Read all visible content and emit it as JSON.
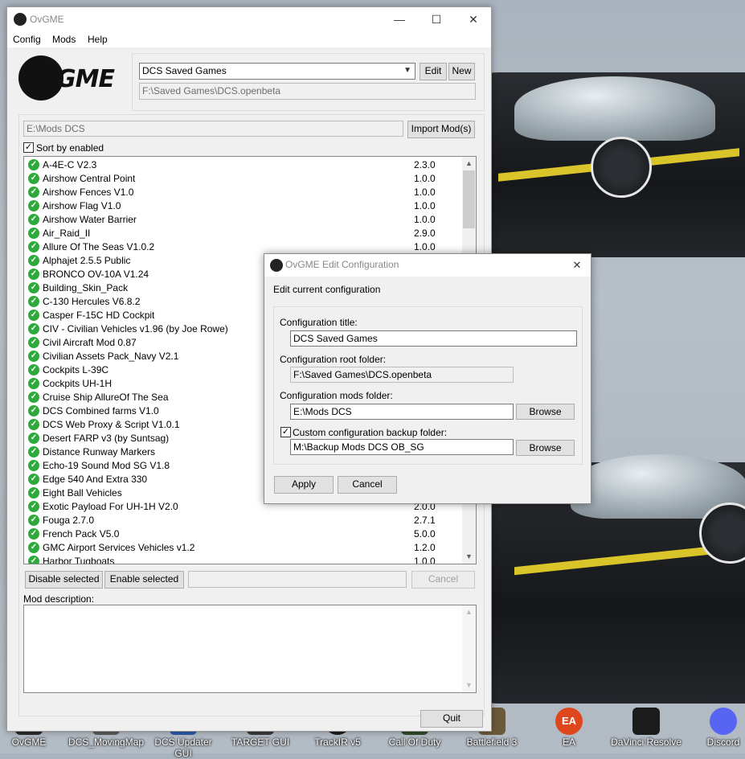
{
  "main_window": {
    "title": "OvGME",
    "logo_text": "OvGME",
    "menu": [
      "Config",
      "Mods",
      "Help"
    ],
    "config_select": "DCS Saved Games",
    "edit_label": "Edit",
    "new_label": "New",
    "config_path": "F:\\Saved Games\\DCS.openbeta",
    "mods_path": "E:\\Mods DCS",
    "import_label": "Import Mod(s)",
    "sort_label": "Sort by enabled",
    "mods": [
      {
        "name": "A-4E-C V2.3",
        "version": "2.3.0"
      },
      {
        "name": "Airshow Central Point",
        "version": "1.0.0"
      },
      {
        "name": "Airshow Fences V1.0",
        "version": "1.0.0"
      },
      {
        "name": "Airshow Flag V1.0",
        "version": "1.0.0"
      },
      {
        "name": "Airshow Water Barrier",
        "version": "1.0.0"
      },
      {
        "name": "Air_Raid_II",
        "version": "2.9.0"
      },
      {
        "name": "Allure Of The Seas V1.0.2",
        "version": "1.0.0"
      },
      {
        "name": "Alphajet 2.5.5 Public",
        "version": ""
      },
      {
        "name": "BRONCO OV-10A V1.24",
        "version": ""
      },
      {
        "name": "Building_Skin_Pack",
        "version": ""
      },
      {
        "name": "C-130 Hercules V6.8.2",
        "version": ""
      },
      {
        "name": "Casper F-15C HD Cockpit",
        "version": ""
      },
      {
        "name": "CIV - Civilian Vehicles v1.96 (by Joe Rowe)",
        "version": ""
      },
      {
        "name": "Civil Aircraft Mod 0.87",
        "version": ""
      },
      {
        "name": "Civilian Assets Pack_Navy V2.1",
        "version": ""
      },
      {
        "name": "Cockpits L-39C",
        "version": ""
      },
      {
        "name": "Cockpits UH-1H",
        "version": ""
      },
      {
        "name": "Cruise Ship AllureOf The Sea",
        "version": ""
      },
      {
        "name": "DCS Combined farms V1.0",
        "version": ""
      },
      {
        "name": "DCS Web Proxy & Script V1.0.1",
        "version": ""
      },
      {
        "name": "Desert FARP v3 (by Suntsag)",
        "version": ""
      },
      {
        "name": "Distance Runway Markers",
        "version": ""
      },
      {
        "name": "Echo-19 Sound Mod SG V1.8",
        "version": ""
      },
      {
        "name": "Edge 540 And Extra 330",
        "version": ""
      },
      {
        "name": "Eight Ball Vehicles",
        "version": ""
      },
      {
        "name": "Exotic Payload For UH-1H V2.0",
        "version": "2.0.0"
      },
      {
        "name": "Fouga 2.7.0",
        "version": "2.7.1"
      },
      {
        "name": "French Pack V5.0",
        "version": "5.0.0"
      },
      {
        "name": "GMC Airport Services Vehicles v1.2",
        "version": "1.2.0"
      },
      {
        "name": "Harbor Tugboats",
        "version": "1.0.0"
      }
    ],
    "disable_label": "Disable selected",
    "enable_label": "Enable selected",
    "cancel_label": "Cancel",
    "description_label": "Mod description:",
    "quit_label": "Quit"
  },
  "dialog": {
    "title": "OvGME Edit Configuration",
    "heading": "Edit current configuration",
    "config_title_label": "Configuration title:",
    "config_title_value": "DCS Saved Games",
    "root_label": "Configuration root folder:",
    "root_value": "F:\\Saved Games\\DCS.openbeta",
    "mods_label": "Configuration mods folder:",
    "mods_value": "E:\\Mods DCS",
    "browse_label": "Browse",
    "backup_label": "Custom configuration backup folder:",
    "backup_value": "M:\\Backup Mods DCS OB_SG",
    "apply_label": "Apply",
    "cancel_label": "Cancel"
  },
  "taskbar": [
    {
      "label": "OvGME",
      "color": "#2b2b2b"
    },
    {
      "label": "DCS_MovingMap",
      "color": "#5a5a5a"
    },
    {
      "label": "DCS Updater GUI",
      "color": "#2d5aa8"
    },
    {
      "label": "TARGET GUI",
      "color": "#3a3a3a"
    },
    {
      "label": "TrackIR v5",
      "color": "#1e1e1e"
    },
    {
      "label": "Call Of Duty",
      "color": "#2f4a2a"
    },
    {
      "label": "Battlefield 3",
      "color": "#6b5a3a"
    },
    {
      "label": "EA",
      "color": "#e0461e"
    },
    {
      "label": "DaVinci Resolve",
      "color": "#1c1c1c"
    },
    {
      "label": "Discord",
      "color": "#5865f2"
    }
  ]
}
